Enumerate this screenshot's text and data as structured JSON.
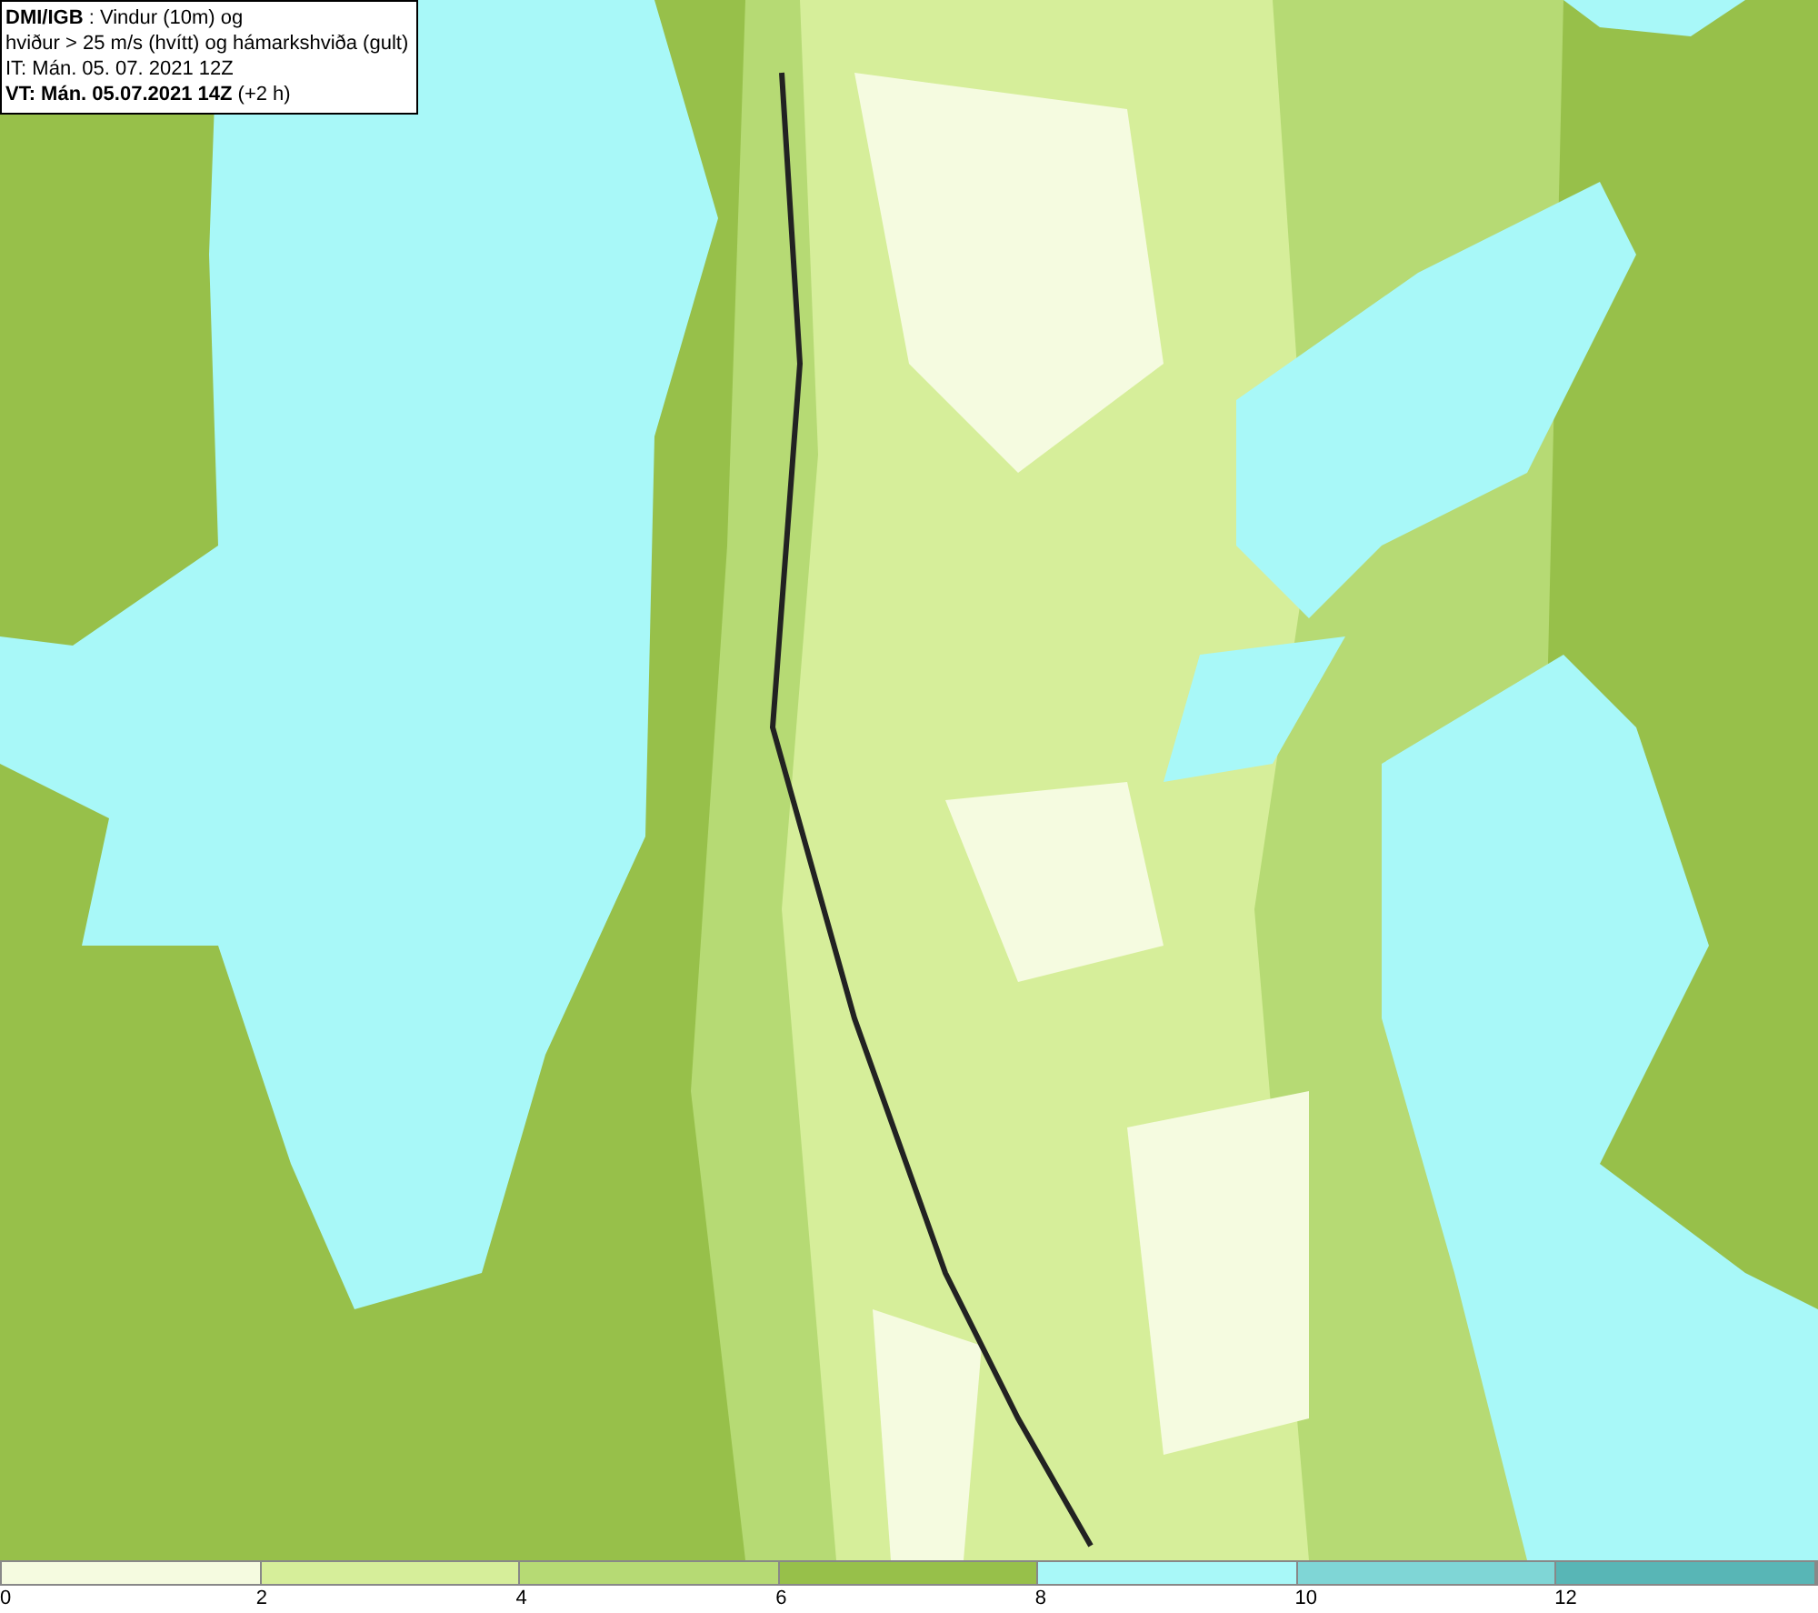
{
  "header": {
    "lines": [
      "**DMI/IGB** : Vindur (10m) og",
      "hviður > 25 m/s (hvítt) og hámarkshviða (gult)",
      "IT: Mán. 05. 07. 2021 12Z",
      "**VT: Mán. 05.07.2021 14Z** (+2 h)"
    ]
  },
  "legend": {
    "bins": [
      {
        "label": "0",
        "color": "#f5fbe0"
      },
      {
        "label": "2",
        "color": "#d6ee9a"
      },
      {
        "label": "4",
        "color": "#b6da74"
      },
      {
        "label": "6",
        "color": "#97c04a"
      },
      {
        "label": "8",
        "color": "#a8f8f8"
      },
      {
        "label": "10",
        "color": "#7fd6d6"
      },
      {
        "label": "12",
        "color": "#58b6b6"
      }
    ]
  }
}
